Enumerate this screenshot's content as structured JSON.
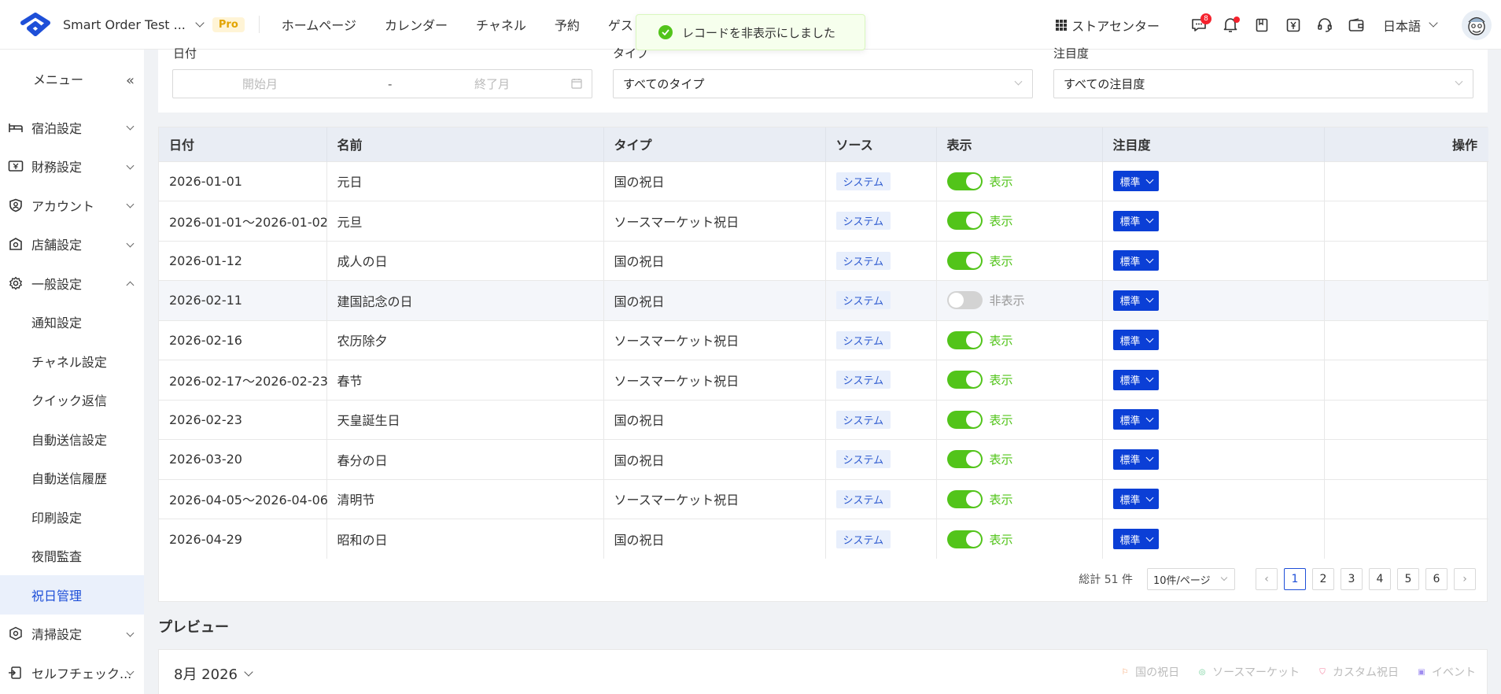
{
  "header": {
    "store_name": "Smart Order Test ...",
    "pro_badge": "Pro",
    "nav": [
      "ホームページ",
      "カレンダー",
      "チャネル",
      "予約",
      "ゲスト"
    ],
    "store_center": "ストアセンター",
    "notification_count": "8",
    "language": "日本語"
  },
  "toast": {
    "message": "レコードを非表示にしました"
  },
  "sidebar": {
    "menu_label": "メニュー",
    "items": [
      {
        "label": "宿泊設定",
        "icon": "bed-icon"
      },
      {
        "label": "財務設定",
        "icon": "finance-icon"
      },
      {
        "label": "アカウント",
        "icon": "account-icon"
      },
      {
        "label": "店舗設定",
        "icon": "store-icon"
      },
      {
        "label": "一般設定",
        "icon": "gear-icon"
      }
    ],
    "sub_items": [
      "通知設定",
      "チャネル設定",
      "クイック返信",
      "自動送信設定",
      "自動送信履歴",
      "印刷設定",
      "夜間監査",
      "祝日管理"
    ],
    "active_sub": "祝日管理",
    "bottom_items": [
      {
        "label": "清掃設定",
        "icon": "cleaning-icon"
      },
      {
        "label": "セルフチェック...",
        "icon": "self-checkin-icon"
      }
    ]
  },
  "filters": {
    "date_label": "日付",
    "start_placeholder": "開始月",
    "range_sep": "-",
    "end_placeholder": "終了月",
    "type_label": "タイプ",
    "type_value": "すべてのタイプ",
    "attention_label": "注目度",
    "attention_value": "すべての注目度"
  },
  "table": {
    "headers": [
      "日付",
      "名前",
      "タイプ",
      "ソース",
      "表示",
      "注目度",
      "操作"
    ],
    "rows": [
      {
        "date": "2026-01-01",
        "name": "元日",
        "type": "国の祝日",
        "source": "システム",
        "visible": true,
        "visible_label": "表示",
        "attention": "標準"
      },
      {
        "date": "2026-01-01～2026-01-02",
        "name": "元旦",
        "type": "ソースマーケット祝日",
        "source": "システム",
        "visible": true,
        "visible_label": "表示",
        "attention": "標準"
      },
      {
        "date": "2026-01-12",
        "name": "成人の日",
        "type": "国の祝日",
        "source": "システム",
        "visible": true,
        "visible_label": "表示",
        "attention": "標準"
      },
      {
        "date": "2026-02-11",
        "name": "建国記念の日",
        "type": "国の祝日",
        "source": "システム",
        "visible": false,
        "visible_label": "非表示",
        "attention": "標準"
      },
      {
        "date": "2026-02-16",
        "name": "农历除夕",
        "type": "ソースマーケット祝日",
        "source": "システム",
        "visible": true,
        "visible_label": "表示",
        "attention": "標準"
      },
      {
        "date": "2026-02-17～2026-02-23",
        "name": "春节",
        "type": "ソースマーケット祝日",
        "source": "システム",
        "visible": true,
        "visible_label": "表示",
        "attention": "標準"
      },
      {
        "date": "2026-02-23",
        "name": "天皇誕生日",
        "type": "国の祝日",
        "source": "システム",
        "visible": true,
        "visible_label": "表示",
        "attention": "標準"
      },
      {
        "date": "2026-03-20",
        "name": "春分の日",
        "type": "国の祝日",
        "source": "システム",
        "visible": true,
        "visible_label": "表示",
        "attention": "標準"
      },
      {
        "date": "2026-04-05～2026-04-06",
        "name": "清明节",
        "type": "ソースマーケット祝日",
        "source": "システム",
        "visible": true,
        "visible_label": "表示",
        "attention": "標準"
      },
      {
        "date": "2026-04-29",
        "name": "昭和の日",
        "type": "国の祝日",
        "source": "システム",
        "visible": true,
        "visible_label": "表示",
        "attention": "標準"
      }
    ]
  },
  "pagination": {
    "total": "総計 51 件",
    "page_size": "10件/ページ",
    "pages": [
      "1",
      "2",
      "3",
      "4",
      "5",
      "6"
    ],
    "current": "1"
  },
  "preview": {
    "title": "プレビュー",
    "month": "8月 2026",
    "legend": [
      {
        "label": "国の祝日",
        "color": "#f7a26b"
      },
      {
        "label": "ソースマーケット",
        "color": "#6fcf97"
      },
      {
        "label": "カスタム祝日",
        "color": "#f47c9c"
      },
      {
        "label": "イベント",
        "color": "#9f8cf0"
      }
    ]
  },
  "colors": {
    "accent": "#1e4fd8",
    "attention_button": "#0b3fd6",
    "toggle_on": "#52c41a",
    "source_tag_bg": "#e8effc"
  }
}
